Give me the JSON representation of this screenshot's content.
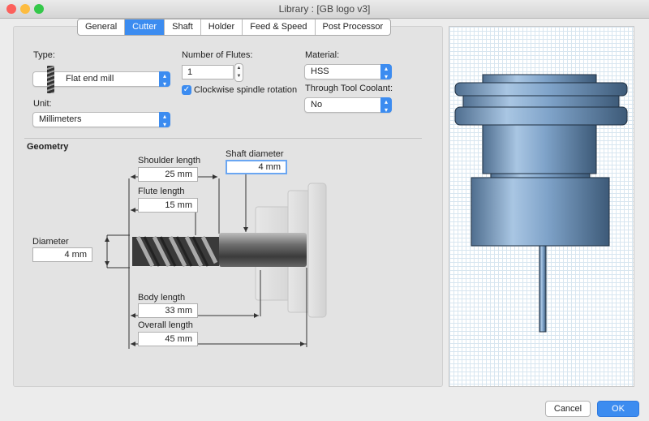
{
  "window": {
    "title": "Library : [GB logo v3]"
  },
  "tabs": [
    "General",
    "Cutter",
    "Shaft",
    "Holder",
    "Feed & Speed",
    "Post Processor"
  ],
  "active_tab": "Cutter",
  "cutter": {
    "type_label": "Type:",
    "type_value": "Flat end mill",
    "flutes_label": "Number of Flutes:",
    "flutes_value": "1",
    "clockwise_label": "Clockwise spindle rotation",
    "clockwise_checked": true,
    "material_label": "Material:",
    "material_value": "HSS",
    "unit_label": "Unit:",
    "unit_value": "Millimeters",
    "coolant_label": "Through Tool Coolant:",
    "coolant_value": "No"
  },
  "geometry": {
    "heading": "Geometry",
    "shoulder_length_label": "Shoulder length",
    "shoulder_length_value": "25 mm",
    "shaft_diameter_label": "Shaft diameter",
    "shaft_diameter_value": "4 mm",
    "flute_length_label": "Flute length",
    "flute_length_value": "15 mm",
    "diameter_label": "Diameter",
    "diameter_value": "4 mm",
    "body_length_label": "Body length",
    "body_length_value": "33 mm",
    "overall_length_label": "Overall length",
    "overall_length_value": "45 mm"
  },
  "buttons": {
    "cancel": "Cancel",
    "ok": "OK"
  },
  "colors": {
    "accent": "#3c8cf0",
    "holder": "#7fa3c9"
  }
}
